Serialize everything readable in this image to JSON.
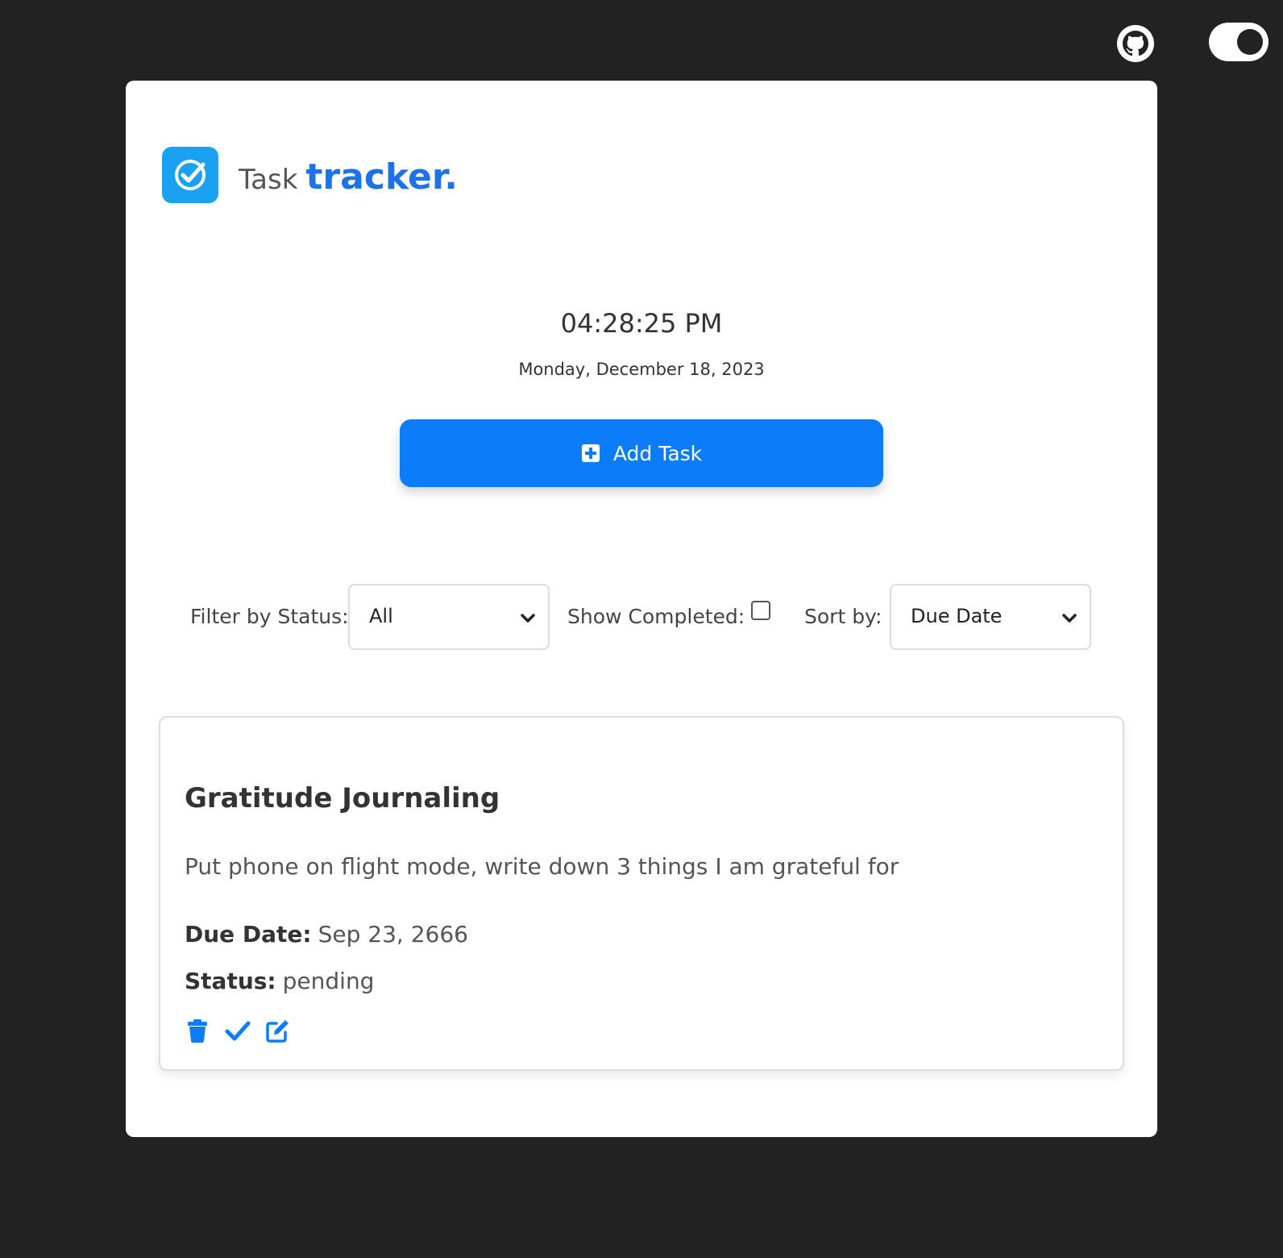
{
  "brand": {
    "word1": "Task",
    "word2": "tracker."
  },
  "clock": {
    "time": "04:28:25 PM",
    "date": "Monday, December 18, 2023"
  },
  "add_button": {
    "label": "Add Task"
  },
  "filters": {
    "status_label": "Filter by Status:",
    "status_value": "All",
    "show_completed_label": "Show Completed:",
    "show_completed_checked": false,
    "sort_label": "Sort by:",
    "sort_value": "Due Date"
  },
  "task": {
    "title": "Gratitude Journaling",
    "description": "Put phone on flight mode, write down 3 things I am grateful for",
    "due_label": "Due Date:",
    "due_value": "Sep 23, 2666",
    "status_label": "Status:",
    "status_value": "pending"
  },
  "colors": {
    "background": "#222222",
    "accent": "#0d7cf8",
    "brand_blue": "#1c72e8",
    "logo": "#1ba1f2",
    "card": "#ffffff"
  },
  "icons": {
    "github": "github-icon",
    "toggle": "theme-toggle",
    "logo": "check-icon",
    "add": "plus-square-icon",
    "delete": "trash-icon",
    "complete": "check-icon",
    "edit": "edit-icon",
    "dropdown": "chevron-down-icon"
  }
}
